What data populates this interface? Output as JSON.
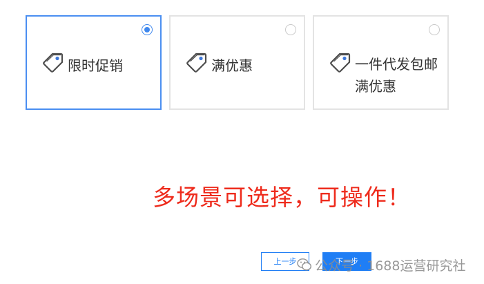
{
  "options": [
    {
      "label": "限时促销",
      "selected": true
    },
    {
      "label": "满优惠",
      "selected": false
    },
    {
      "label": "一件代发包邮满优惠",
      "selected": false
    }
  ],
  "headline": "多场景可选择，可操作！",
  "buttons": {
    "prev_label": "上一步",
    "next_label": "下一步"
  },
  "watermark": {
    "text": "公众号 · 1688运营研究社"
  },
  "colors": {
    "accent": "#1f7ef5",
    "selected_border": "#4a8ef1",
    "headline": "#ee2b1c",
    "card_border": "#e3e3e3"
  }
}
